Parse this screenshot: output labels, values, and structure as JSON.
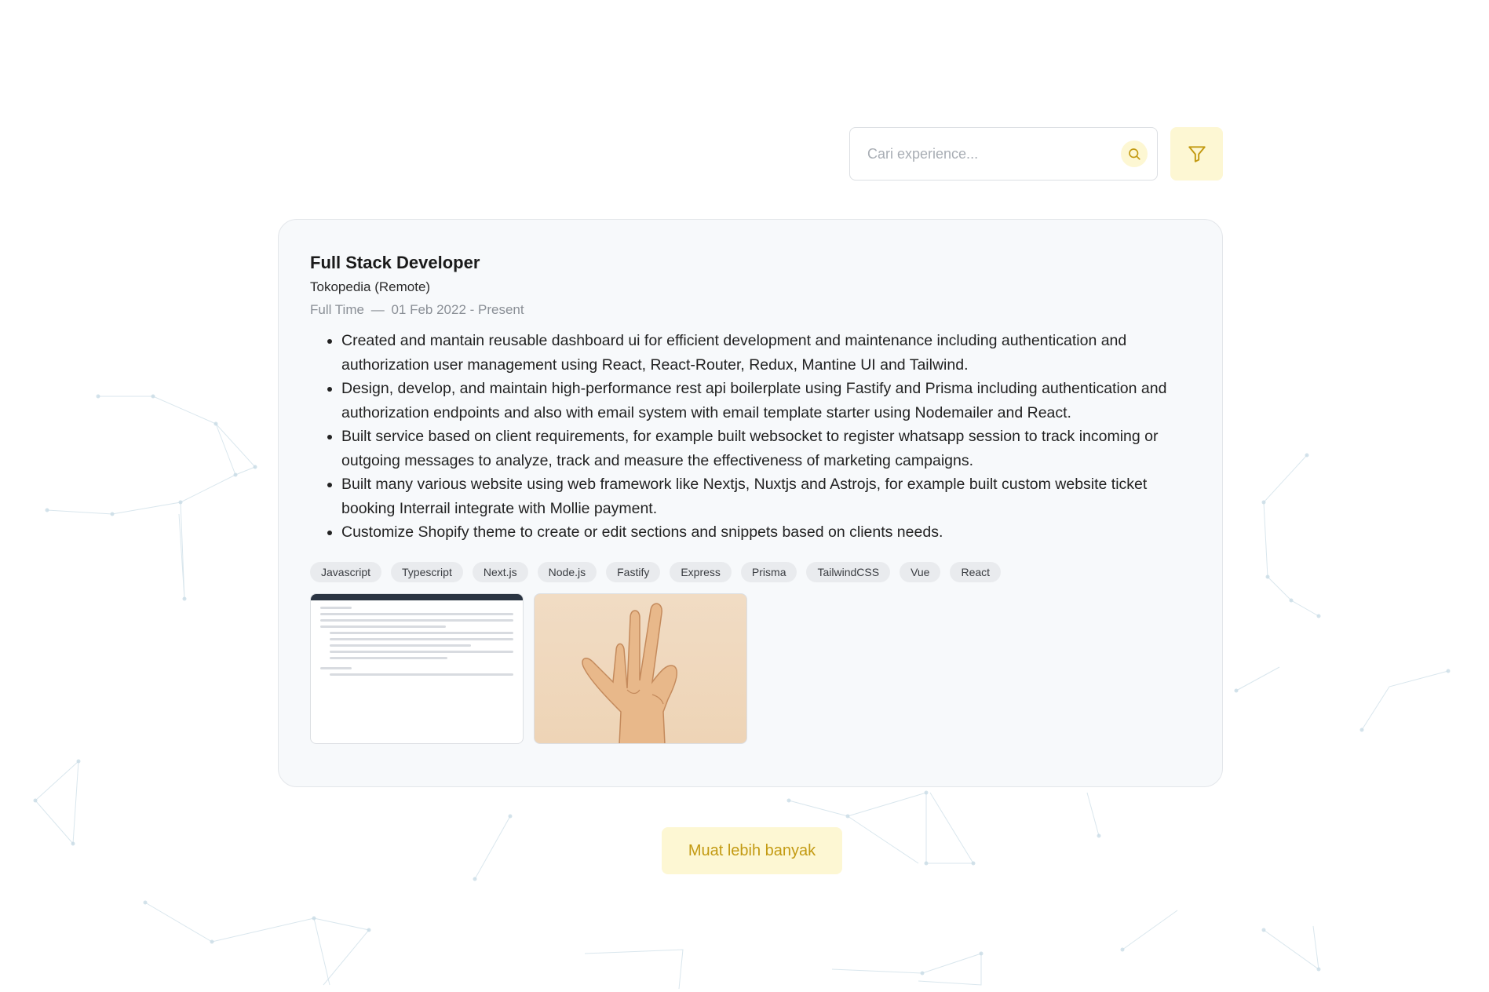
{
  "search": {
    "placeholder": "Cari experience..."
  },
  "experience": {
    "title": "Full Stack Developer",
    "company": "Tokopedia (Remote)",
    "employment_type": "Full Time",
    "separator": "—",
    "period": "01 Feb 2022 - Present",
    "responsibilities": [
      "Created and mantain reusable dashboard ui for efficient development and maintenance including authentication and authorization user management using React, React-Router, Redux, Mantine UI and Tailwind.",
      "Design, develop, and maintain high-performance rest api boilerplate using Fastify and Prisma including authentication and authorization endpoints and also with email system with email template starter using Nodemailer and React.",
      "Built service based on client requirements, for example built websocket to register whatsapp session to track incoming or outgoing messages to analyze, track and measure the effectiveness of marketing campaigns.",
      "Built many various website using web framework like Nextjs, Nuxtjs and Astrojs, for example built custom website ticket booking Interrail integrate with Mollie payment.",
      "Customize Shopify theme to create or edit sections and snippets based on clients needs."
    ],
    "tags": [
      "Javascript",
      "Typescript",
      "Next.js",
      "Node.js",
      "Fastify",
      "Express",
      "Prisma",
      "TailwindCSS",
      "Vue",
      "React"
    ]
  },
  "load_more": {
    "label": "Muat lebih banyak"
  },
  "colors": {
    "accent_bg": "#fdf7d3",
    "accent_text": "#c39a12",
    "card_bg": "#f7f9fb"
  },
  "icons": {
    "search": "search-icon",
    "filter": "filter-icon"
  }
}
